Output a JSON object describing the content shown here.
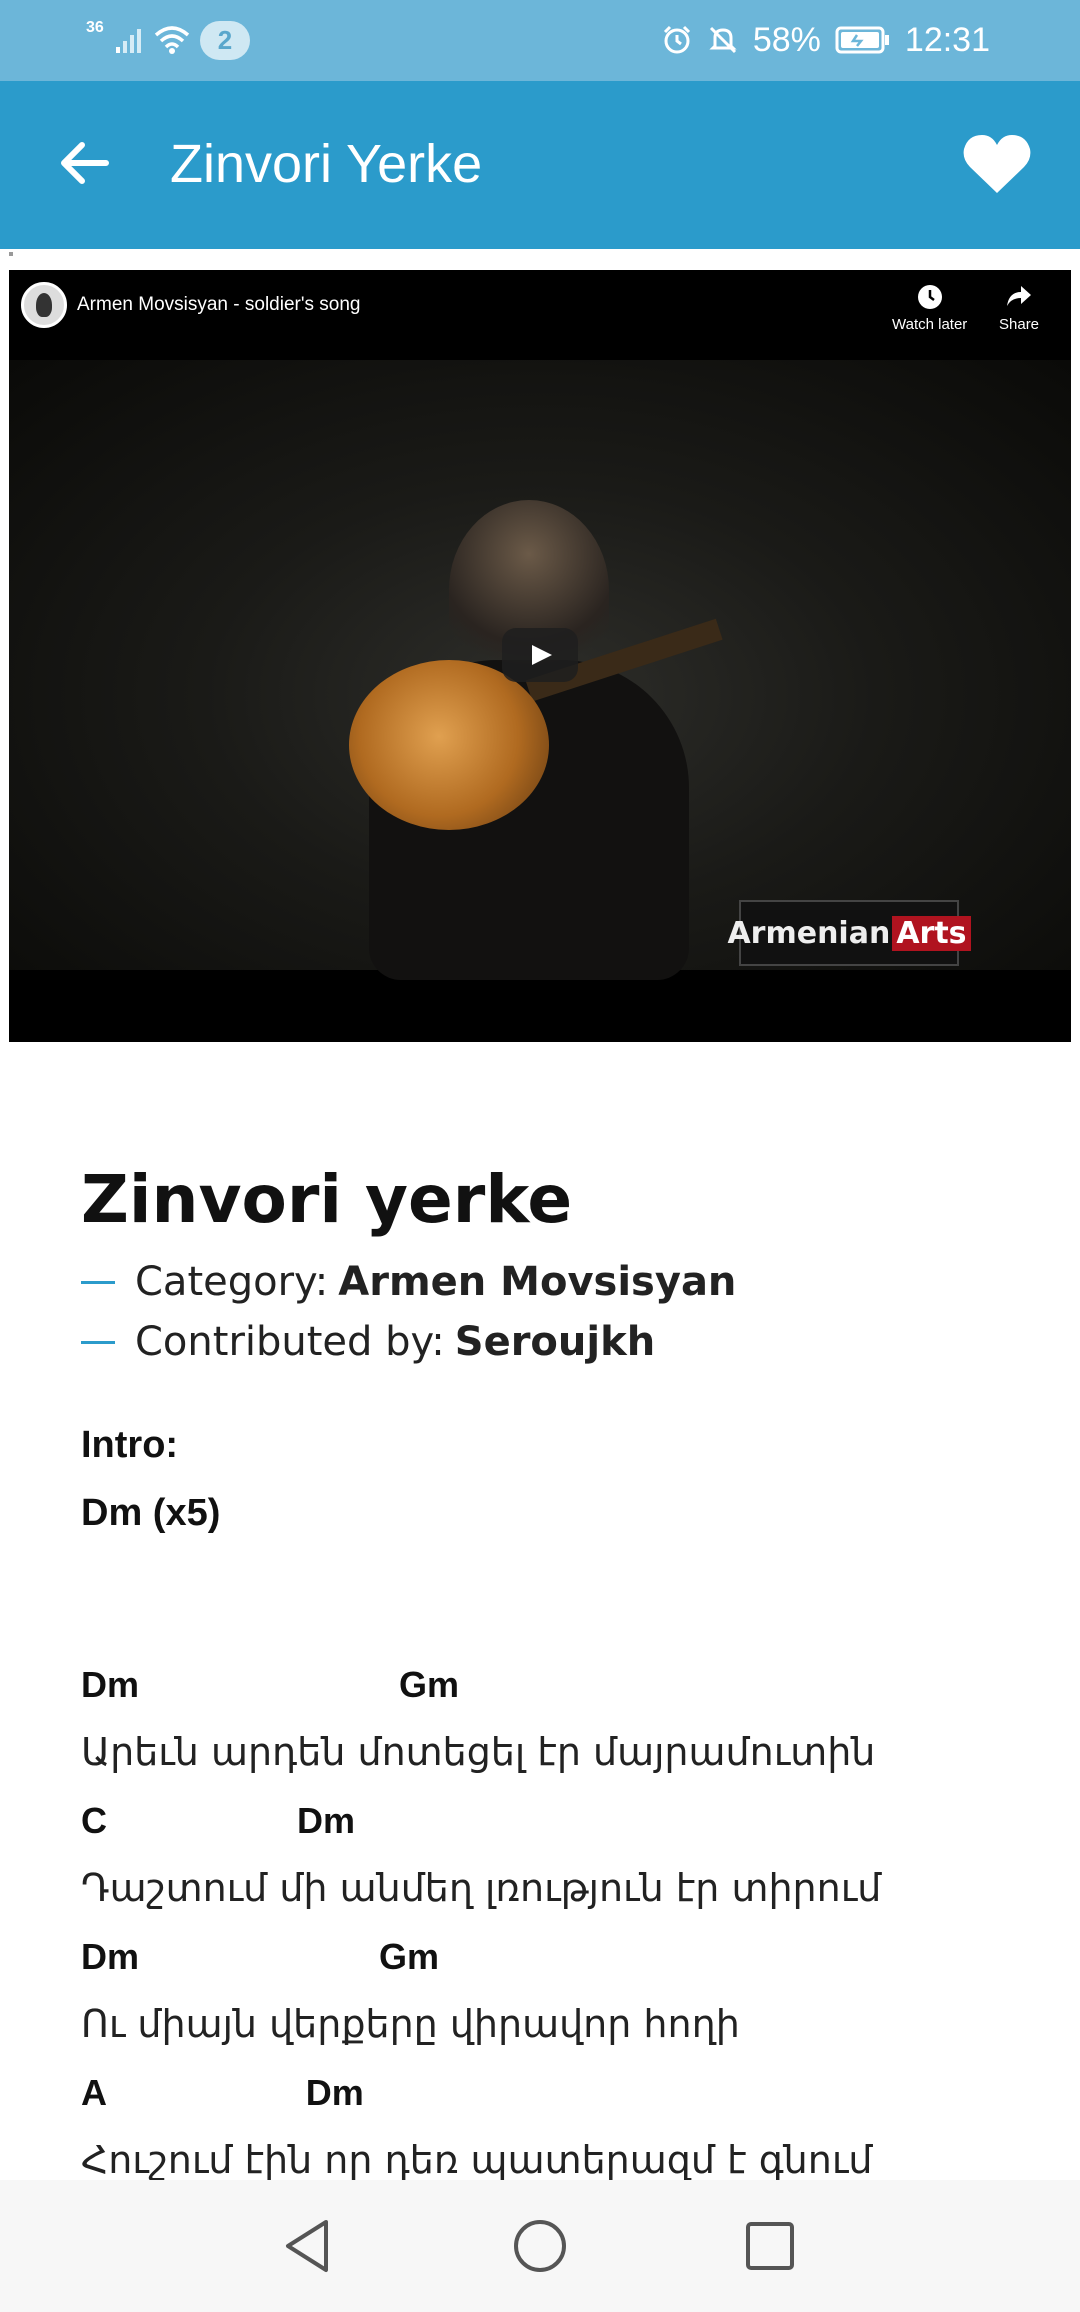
{
  "status_bar": {
    "network_type": "36",
    "notification_count": "2",
    "battery": "58%",
    "time": "12:31"
  },
  "app_bar": {
    "title": "Zinvori Yerke"
  },
  "video": {
    "title": "Armen Movsisyan - soldier's song",
    "watch_later_label": "Watch later",
    "share_label": "Share",
    "watermark_text_1": "Armenian",
    "watermark_text_2": "Arts"
  },
  "song": {
    "title": "Zinvori yerke",
    "category_label": "Category:",
    "category_value": "Armen Movsisyan",
    "contributor_label": "Contributed by:",
    "contributor_value": "Seroujkh",
    "intro_label": "Intro:",
    "intro_chords": "Dm  (x5)",
    "lines": [
      {
        "chords": "Dm                          Gm",
        "lyric": "Արեւն արդեն մոտեցել էր մայրամուտին"
      },
      {
        "chords": "C                   Dm",
        "lyric": "Դաշտում մի անմեղ լռություն էր տիրում"
      },
      {
        "chords": "Dm                        Gm",
        "lyric": "Ու միայն վերքերը վիրավոր հողի"
      },
      {
        "chords": "A                    Dm",
        "lyric": "Հուշում էին որ դեռ պատերազմ է գնում"
      }
    ]
  },
  "colors": {
    "status_bar": "#6cb6d9",
    "app_bar": "#2b9bcb",
    "accent": "#2b9bcb"
  },
  "icons": {
    "back": "arrow-left-icon",
    "favorite": "heart-icon",
    "nav_back": "triangle-back-icon",
    "nav_home": "circle-home-icon",
    "nav_recents": "square-recents-icon"
  }
}
